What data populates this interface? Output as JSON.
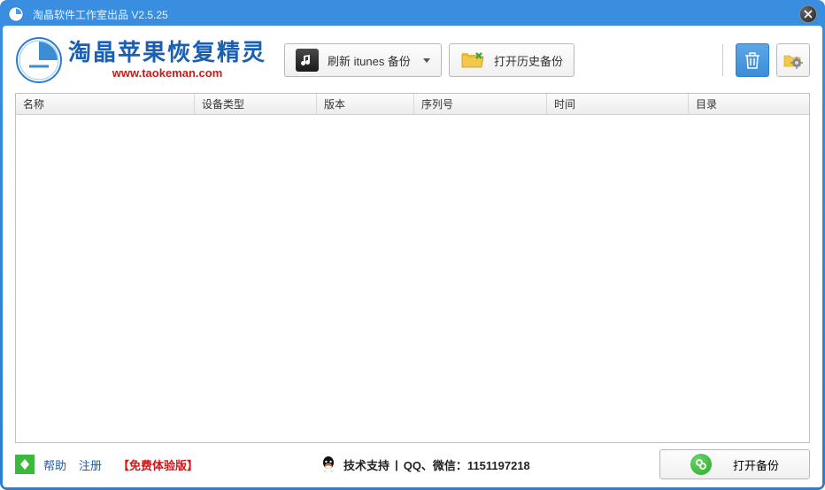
{
  "titlebar": {
    "text": "淘晶软件工作室出品 V2.5.25"
  },
  "header": {
    "app_title": "淘晶苹果恢复精灵",
    "app_url": "www.taokeman.com",
    "refresh_btn": "刷新 itunes 备份",
    "history_btn": "打开历史备份"
  },
  "table": {
    "columns": {
      "name": "名称",
      "type": "设备类型",
      "version": "版本",
      "serial": "序列号",
      "time": "时间",
      "dir": "目录"
    },
    "rows": []
  },
  "footer": {
    "help": "帮助",
    "register": "注册",
    "trial": "【免费体验版】",
    "support_label": "技术支持",
    "support_contact": "QQ、微信：1151197218",
    "open_backup": "打开备份"
  }
}
